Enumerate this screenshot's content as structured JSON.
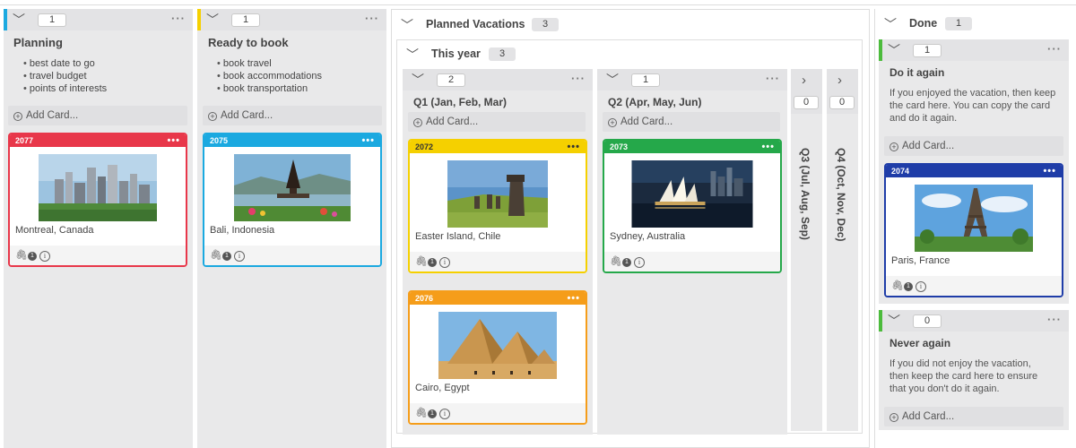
{
  "columns": {
    "planning": {
      "count": "1",
      "title": "Planning",
      "bullets": [
        "best date to go",
        "travel budget",
        "points of interests"
      ],
      "add_card": "Add Card...",
      "accent": "#1ba9e0"
    },
    "ready": {
      "count": "1",
      "title": "Ready to book",
      "bullets": [
        "book travel",
        "book accommodations",
        "book transportation"
      ],
      "add_card": "Add Card...",
      "accent": "#f5d000"
    },
    "planned": {
      "title": "Planned Vacations",
      "count": "3",
      "this_year": {
        "title": "This year",
        "count": "3",
        "q1": {
          "count": "2",
          "title": "Q1 (Jan, Feb, Mar)",
          "add_card": "Add Card..."
        },
        "q2": {
          "count": "1",
          "title": "Q2 (Apr, May, Jun)",
          "add_card": "Add Card..."
        },
        "q3": {
          "count": "0",
          "title": "Q3 (Jul, Aug, Sep)"
        },
        "q4": {
          "count": "0",
          "title": "Q4 (Oct, Nov, Dec)"
        }
      }
    },
    "done": {
      "title": "Done",
      "count": "1",
      "do_it_again": {
        "count": "1",
        "title": "Do it again",
        "desc": "If you enjoyed the vacation, then keep the card here. You can copy the card and do it again.",
        "add_card": "Add Card...",
        "accent": "#4cbb3c"
      },
      "never_again": {
        "count": "0",
        "title": "Never again",
        "desc": "If you did not enjoy the vacation, then keep the card here to ensure that you don't do it again.",
        "add_card": "Add Card...",
        "accent": "#4cbb3c"
      }
    }
  },
  "cards": {
    "c2077": {
      "id": "2077",
      "label": "Montreal, Canada",
      "attachments": "1",
      "color": "#e8374a"
    },
    "c2075": {
      "id": "2075",
      "label": "Bali, Indonesia",
      "attachments": "1",
      "color": "#1ba9e0"
    },
    "c2072": {
      "id": "2072",
      "label": "Easter Island, Chile",
      "attachments": "1",
      "color": "#f5d000"
    },
    "c2076": {
      "id": "2076",
      "label": "Cairo, Egypt",
      "attachments": "1",
      "color": "#f59d1a"
    },
    "c2073": {
      "id": "2073",
      "label": "Sydney, Australia",
      "attachments": "1",
      "color": "#25a84a"
    },
    "c2074": {
      "id": "2074",
      "label": "Paris, France",
      "attachments": "1",
      "color": "#1f3da8"
    }
  },
  "icons": {
    "collapse": "chevron-down-icon",
    "expand": "chevron-right-icon",
    "more": "more-dots-icon",
    "add": "plus-circle-icon",
    "attachment": "paperclip-icon",
    "info": "info-icon"
  }
}
